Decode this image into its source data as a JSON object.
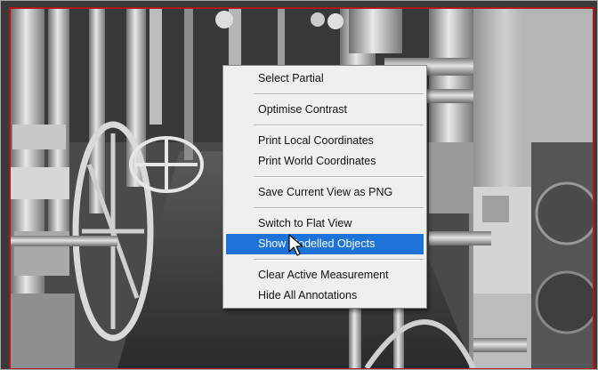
{
  "viewport": {
    "image_subject": "point-cloud-industrial-piping",
    "frame_color": "#b01818"
  },
  "context_menu": {
    "groups": [
      [
        {
          "label": "Select Partial"
        }
      ],
      [
        {
          "label": "Optimise Contrast"
        }
      ],
      [
        {
          "label": "Print Local Coordinates"
        },
        {
          "label": "Print World Coordinates"
        }
      ],
      [
        {
          "label": "Save Current View as PNG"
        }
      ],
      [
        {
          "label": "Switch to Flat View"
        },
        {
          "label": "Show Modelled Objects",
          "highlighted": true
        }
      ],
      [
        {
          "label": "Clear Active Measurement"
        },
        {
          "label": "Hide All Annotations"
        }
      ]
    ],
    "highlight_color": "#1e73d8"
  },
  "cursor": {
    "icon": "arrow-pointer-icon"
  }
}
